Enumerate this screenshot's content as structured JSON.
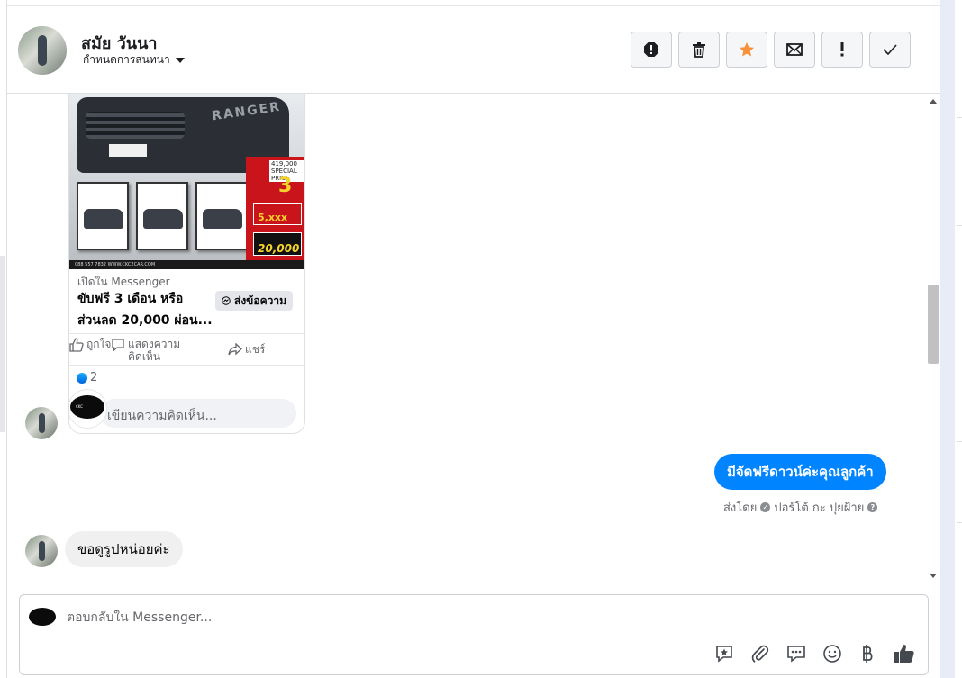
{
  "header": {
    "contact_name": "สมัย วันนา",
    "manage_label": "กำหนดการสนทนา"
  },
  "toolbar": [
    {
      "icon": "alert-octagon-icon",
      "name": "spam-button"
    },
    {
      "icon": "trash-icon",
      "name": "delete-button"
    },
    {
      "icon": "star-icon",
      "name": "star-button",
      "color": "#f7923b"
    },
    {
      "icon": "envelope-icon",
      "name": "mark-unread-button"
    },
    {
      "icon": "exclamation-icon",
      "name": "follow-up-button"
    },
    {
      "icon": "check-icon",
      "name": "done-button"
    }
  ],
  "shared_post": {
    "ad_image": {
      "model_word": "RANGER",
      "special_price": "419,000 SPECIAL PRICE",
      "months": "3",
      "monthly": "5,xxx",
      "discount": "20,000",
      "footer_text": "088 557 7832 WWW.CKC2CAR.COM"
    },
    "open_in_label": "เปิดใน Messenger",
    "title": "ขับฟรี 3 เดือน หรือ ส่วนลด 20,000 ผ่อน...",
    "send_message_label": "ส่งข้อความ",
    "actions": {
      "like": "ถูกใจ",
      "comment": "แสดงความคิดเห็น",
      "share": "แชร์"
    },
    "reaction_count": "2",
    "comment_placeholder": "เขียนความคิดเห็น..."
  },
  "messages": [
    {
      "direction": "outgoing",
      "text": "มีจัดฟรีดาวน์ค่ะคุณลูกค้า"
    },
    {
      "direction": "incoming",
      "text": "ขอดูรูปหน่อยค่ะ"
    }
  ],
  "sent_by": {
    "prefix": "ส่งโดย",
    "sender": "ปอร์โต้ กะ ปุยฝ้าย"
  },
  "composer": {
    "placeholder": "ตอบกลับใน Messenger...",
    "tools": [
      "sparkle-chat-icon",
      "paperclip-icon",
      "saved-reply-icon",
      "emoji-icon",
      "baht-icon",
      "thumbs-up-icon"
    ]
  },
  "colors": {
    "brand_blue": "#0084ff",
    "star_orange": "#f7923b",
    "bubble_gray": "#f0f0f0"
  }
}
